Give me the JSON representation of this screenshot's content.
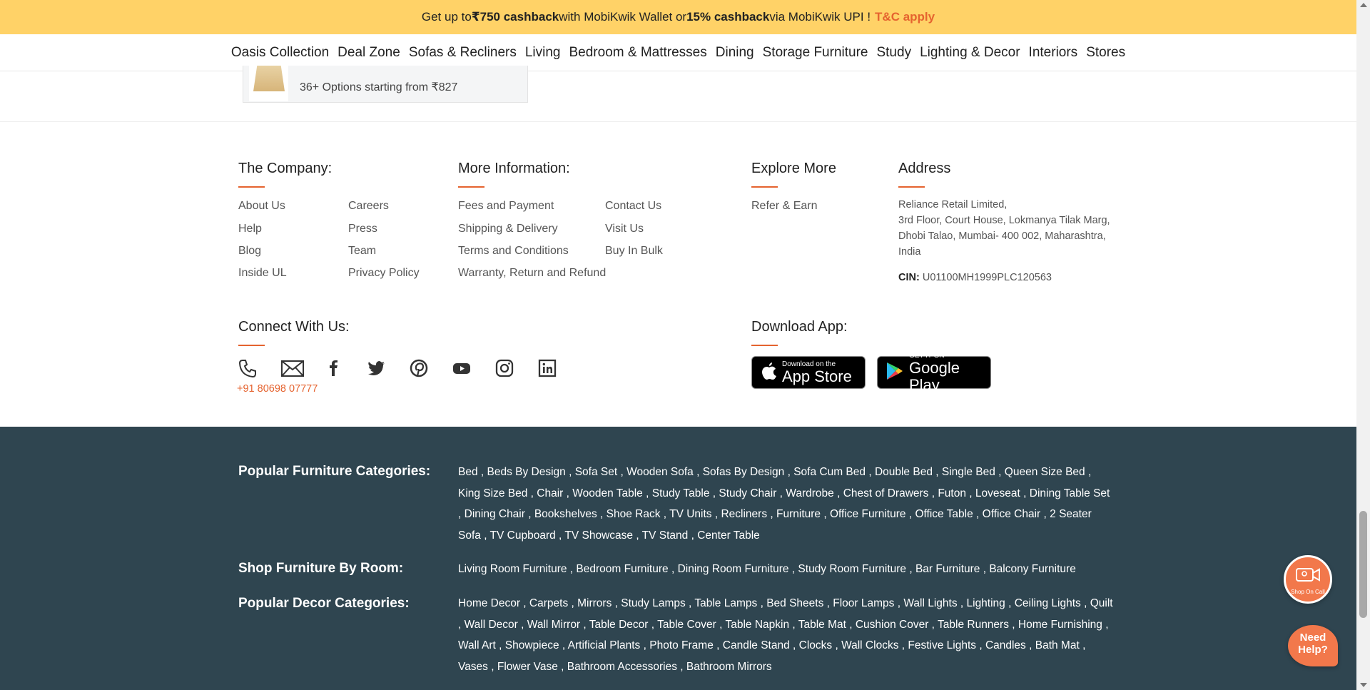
{
  "promo": {
    "pre": "Get up to ",
    "cashback1": "₹750 cashback",
    "mid": " with MobiKwik Wallet or ",
    "cashback2": "15% cashback",
    "post": " via MobiKwik UPI !",
    "tc": "T&C apply"
  },
  "nav": [
    "Oasis Collection",
    "Deal Zone",
    "Sofas & Recliners",
    "Living",
    "Bedroom & Mattresses",
    "Dining",
    "Storage Furniture",
    "Study",
    "Lighting & Decor",
    "Interiors",
    "Stores"
  ],
  "card": {
    "options": "36+ Options starting from ₹827"
  },
  "company": {
    "heading": "The Company:",
    "col1": [
      "About Us",
      "Help",
      "Blog",
      "Inside UL"
    ],
    "col2": [
      "Careers",
      "Press",
      "Team",
      "Privacy Policy"
    ]
  },
  "more_info": {
    "heading": "More Information:",
    "col1": [
      "Fees and Payment",
      "Shipping & Delivery",
      "Terms and Conditions",
      "Warranty, Return and Refund"
    ],
    "col2": [
      "Contact Us",
      "Visit Us",
      "Buy In Bulk"
    ]
  },
  "explore": {
    "heading": "Explore More",
    "items": [
      "Refer & Earn"
    ]
  },
  "address": {
    "heading": "Address",
    "line1": "Reliance Retail Limited,",
    "line2": "3rd Floor, Court House, Lokmanya Tilak Marg,",
    "line3": "Dhobi Talao, Mumbai- 400 002, Maharashtra,",
    "line4": "India",
    "cin_label": "CIN:",
    "cin_value": " U01100MH1999PLC120563"
  },
  "connect": {
    "heading": "Connect With Us:",
    "phone": "+91 80698 07777",
    "icons": [
      "phone-icon",
      "mail-icon",
      "facebook-icon",
      "twitter-icon",
      "pinterest-icon",
      "youtube-icon",
      "instagram-icon",
      "linkedin-icon"
    ]
  },
  "download": {
    "heading": "Download App:",
    "appstore_small": "Download on the",
    "appstore_big": "App Store",
    "play_small": "GET IT ON",
    "play_big": "Google Play"
  },
  "popular_furniture": {
    "heading": "Popular Furniture Categories:",
    "items": [
      "Bed",
      "Beds By Design",
      "Sofa Set",
      "Wooden Sofa",
      "Sofas By Design",
      "Sofa Cum Bed",
      "Double Bed",
      "Single Bed",
      "Queen Size Bed",
      "King Size Bed",
      "Chair",
      "Wooden Table",
      "Study Table",
      "Study Chair",
      "Wardrobe",
      "Chest of Drawers",
      "Futon",
      "Loveseat",
      "Dining Table Set",
      "Dining Chair",
      "Bookshelves",
      "Shoe Rack",
      "TV Units",
      "Recliners",
      "Furniture",
      "Office Furniture",
      "Office Table",
      "Office Chair",
      "2 Seater Sofa",
      "TV Cupboard",
      "TV Showcase",
      "TV Stand",
      "Center Table"
    ]
  },
  "by_room": {
    "heading": "Shop Furniture By Room:",
    "items": [
      "Living Room Furniture",
      "Bedroom Furniture",
      "Dining Room Furniture",
      "Study Room Furniture",
      "Bar Furniture",
      "Balcony Furniture"
    ]
  },
  "popular_decor": {
    "heading": "Popular Decor Categories:",
    "items": [
      "Home Decor",
      "Carpets",
      "Mirrors",
      "Study Lamps",
      "Table Lamps",
      "Bed Sheets",
      "Floor Lamps",
      "Wall Lights",
      "Lighting",
      "Ceiling Lights",
      "Quilt",
      "Wall Decor",
      "Wall Mirror",
      "Table Decor",
      "Table Cover",
      "Table Napkin",
      "Table Mat",
      "Cushion Cover",
      "Table Runners",
      "Home Furnishing",
      "Wall Art",
      "Showpiece",
      "Artificial Plants",
      "Photo Frame",
      "Candle Stand",
      "Clocks",
      "Wall Clocks",
      "Festive Lights",
      "Candles",
      "Bath Mat",
      "Vases",
      "Flower Vase",
      "Bathroom Accessories",
      "Bathroom Mirrors"
    ]
  },
  "floating": {
    "call_label": "Shop On Call",
    "help_line1": "Need",
    "help_line2": "Help?"
  },
  "colors": {
    "accent": "#e5632f",
    "banner": "#ffd267",
    "dark_footer": "#2f4550"
  }
}
